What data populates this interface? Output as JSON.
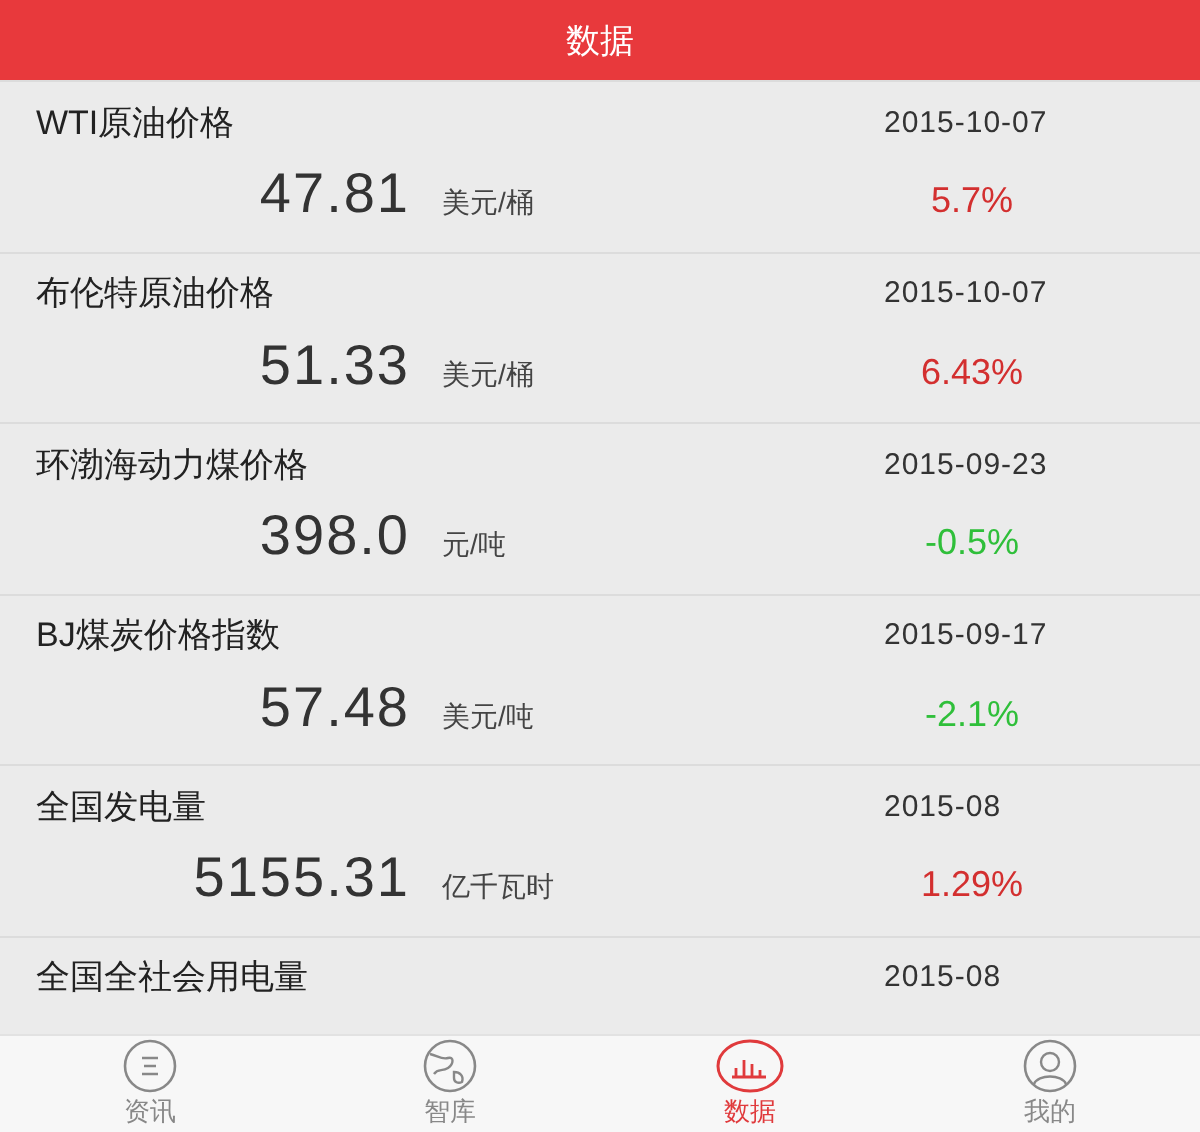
{
  "header": {
    "title": "数据"
  },
  "items": [
    {
      "name": "WTI原油价格",
      "date": "2015-10-07",
      "value": "47.81",
      "unit": "美元/桶",
      "change": "5.7%",
      "color": "#d32f2f"
    },
    {
      "name": "布伦特原油价格",
      "date": "2015-10-07",
      "value": "51.33",
      "unit": "美元/桶",
      "change": "6.43%",
      "color": "#d32f2f"
    },
    {
      "name": "环渤海动力煤价格",
      "date": "2015-09-23",
      "value": "398.0",
      "unit": "元/吨",
      "change": "-0.5%",
      "color": "#2fbf3a"
    },
    {
      "name": "BJ煤炭价格指数",
      "date": "2015-09-17",
      "value": "57.48",
      "unit": "美元/吨",
      "change": "-2.1%",
      "color": "#2fbf3a"
    },
    {
      "name": "全国发电量",
      "date": "2015-08",
      "value": "5155.31",
      "unit": "亿千瓦时",
      "change": "1.29%",
      "color": "#d32f2f"
    },
    {
      "name": "全国全社会用电量",
      "date": "2015-08"
    }
  ],
  "tabs": [
    {
      "label": "资讯",
      "selected": false
    },
    {
      "label": "智库",
      "selected": false
    },
    {
      "label": "数据",
      "selected": true
    },
    {
      "label": "我的",
      "selected": false
    }
  ]
}
